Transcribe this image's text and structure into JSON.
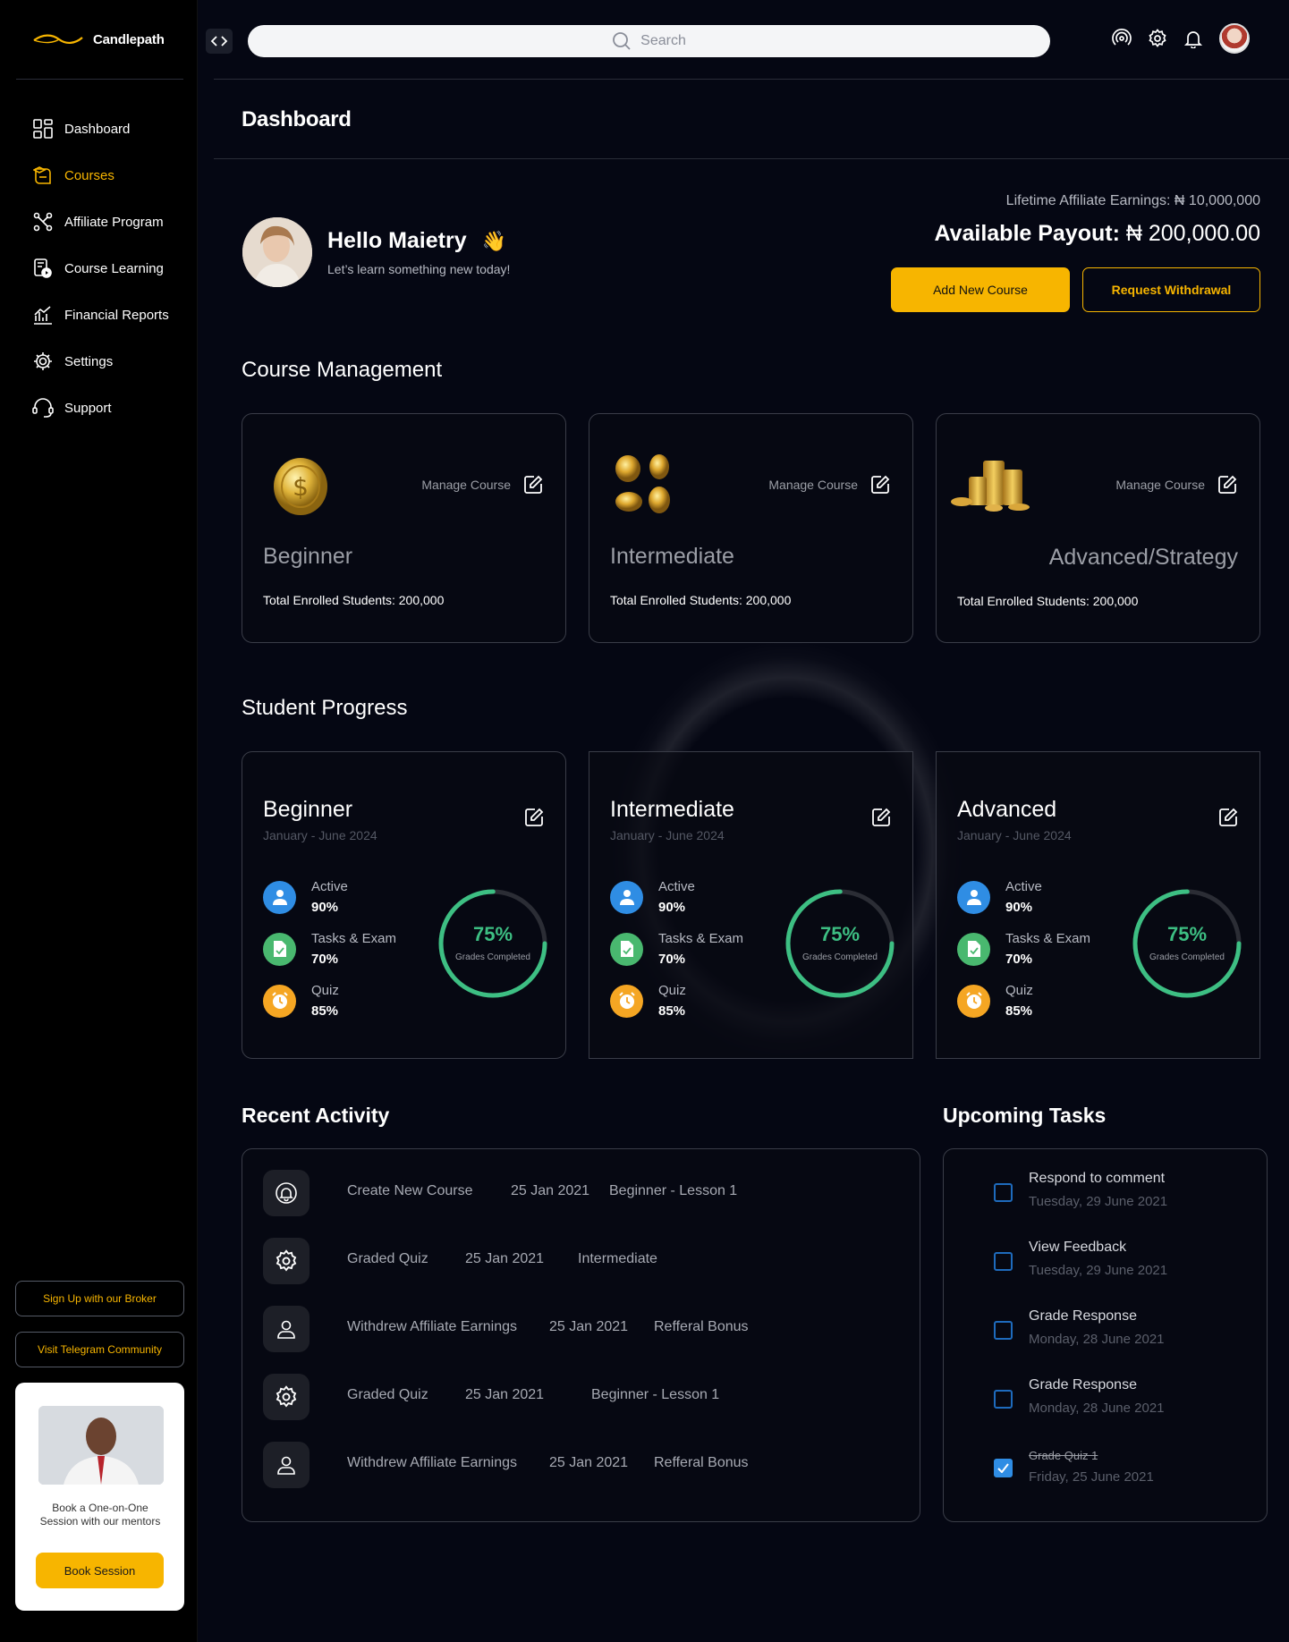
{
  "brand": {
    "name": "Candlepath"
  },
  "search": {
    "placeholder": "Search"
  },
  "sidebar": {
    "items": [
      {
        "label": "Dashboard",
        "icon": "grid-icon",
        "active": false
      },
      {
        "label": "Courses",
        "icon": "book-icon",
        "active": true
      },
      {
        "label": "Affiliate Program",
        "icon": "network-icon",
        "active": false
      },
      {
        "label": "Course Learning",
        "icon": "play-doc-icon",
        "active": false
      },
      {
        "label": "Financial Reports",
        "icon": "chart-icon",
        "active": false
      },
      {
        "label": "Settings",
        "icon": "gear-icon",
        "active": false
      },
      {
        "label": "Support",
        "icon": "headset-icon",
        "active": false
      }
    ],
    "broker_button": "Sign Up with our Broker",
    "telegram_button": "Visit Telegram Community",
    "mentor": {
      "text": "Book a One-on-One Session with our mentors",
      "button": "Book Session"
    }
  },
  "header": {
    "title": "Dashboard"
  },
  "greeting": {
    "title": "Hello Maietry",
    "emoji": "👋",
    "subtitle": "Let’s learn something new today!"
  },
  "earnings": {
    "lifetime": "Lifetime Affiliate Earnings: ₦ 10,000,000",
    "payout_label": "Available Payout:",
    "payout_value": "₦ 200,000.00",
    "add_course_button": "Add New Course",
    "withdraw_button": "Request Withdrawal"
  },
  "course_management": {
    "title": "Course Management",
    "cards": [
      {
        "level": "Beginner",
        "manage": "Manage Course",
        "students": "Total Enrolled Students: 200,000"
      },
      {
        "level": "Intermediate",
        "manage": "Manage Course",
        "students": "Total Enrolled Students: 200,000"
      },
      {
        "level": "Advanced/Strategy",
        "manage": "Manage Course",
        "students": "Total Enrolled Students: 200,000"
      }
    ]
  },
  "student_progress": {
    "title": "Student Progress",
    "cards": [
      {
        "title": "Beginner",
        "period": "January - June 2024",
        "active_label": "Active",
        "active": "90%",
        "tasks_label": "Tasks & Exam",
        "tasks": "70%",
        "quiz_label": "Quiz",
        "quiz": "85%",
        "grade_pct": "75%",
        "grade_label": "Grades Completed",
        "grade_fraction": 0.75
      },
      {
        "title": "Intermediate",
        "period": "January - June 2024",
        "active_label": "Active",
        "active": "90%",
        "tasks_label": "Tasks & Exam",
        "tasks": "70%",
        "quiz_label": "Quiz",
        "quiz": "85%",
        "grade_pct": "75%",
        "grade_label": "Grades Completed",
        "grade_fraction": 0.75
      },
      {
        "title": "Advanced",
        "period": "January - June 2024",
        "active_label": "Active",
        "active": "90%",
        "tasks_label": "Tasks & Exam",
        "tasks": "70%",
        "quiz_label": "Quiz",
        "quiz": "85%",
        "grade_pct": "75%",
        "grade_label": "Grades Completed",
        "grade_fraction": 0.75
      }
    ]
  },
  "recent_activity": {
    "title": "Recent Activity",
    "rows": [
      {
        "icon": "bell-icon",
        "action": "Create New Course",
        "date": "25 Jan 2021",
        "detail": "Beginner - Lesson 1"
      },
      {
        "icon": "gear-icon",
        "action": "Graded Quiz",
        "date": "25 Jan 2021",
        "detail": "Intermediate"
      },
      {
        "icon": "user-icon",
        "action": "Withdrew Affiliate Earnings",
        "date": "25 Jan 2021",
        "detail": "Refferal Bonus"
      },
      {
        "icon": "gear-icon",
        "action": "Graded Quiz",
        "date": "25 Jan 2021",
        "detail": "Beginner - Lesson 1"
      },
      {
        "icon": "user-icon",
        "action": "Withdrew Affiliate Earnings",
        "date": "25 Jan 2021",
        "detail": "Refferal Bonus"
      }
    ]
  },
  "upcoming_tasks": {
    "title": "Upcoming Tasks",
    "items": [
      {
        "name": "Respond to comment",
        "date": "Tuesday, 29 June 2021",
        "done": false
      },
      {
        "name": "View Feedback",
        "date": "Tuesday, 29 June 2021",
        "done": false
      },
      {
        "name": "Grade Response",
        "date": "Monday, 28 June 2021",
        "done": false
      },
      {
        "name": "Grade Response",
        "date": "Monday, 28 June 2021",
        "done": false
      },
      {
        "name": "Grade Quiz 1",
        "date": "Friday, 25 June 2021",
        "done": true
      }
    ]
  },
  "colors": {
    "accent": "#f7b500",
    "background": "#050713",
    "progress_ring": "#3dbf83",
    "active_blue": "#2f8de4",
    "tasks_green": "#49b86f",
    "quiz_orange": "#f5a623"
  }
}
